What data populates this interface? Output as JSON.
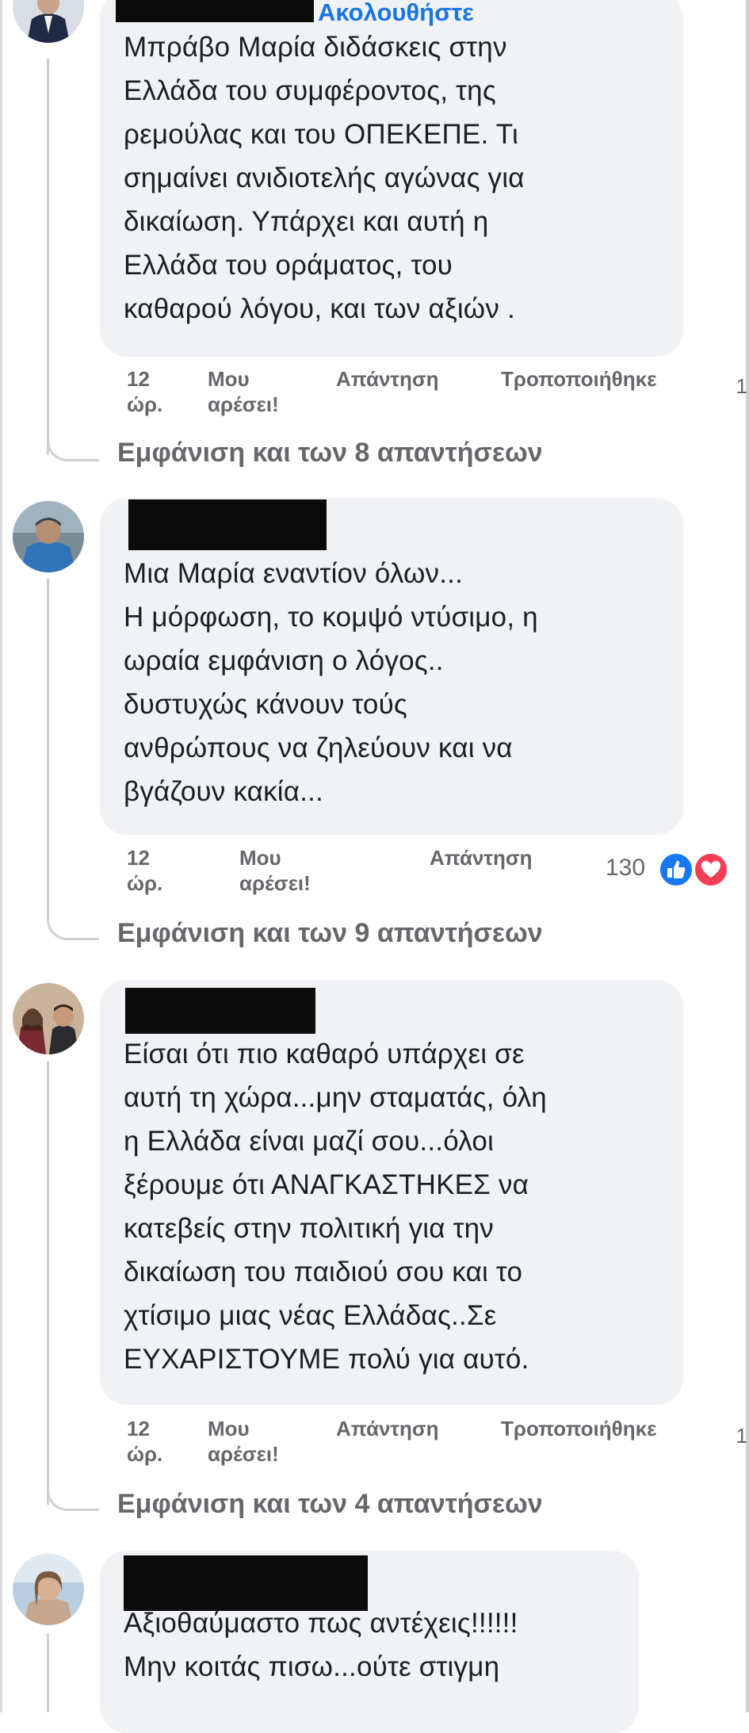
{
  "comments": [
    {
      "follow_label": "Ακολουθήστε",
      "text": "Μπράβο Μαρία διδάσκεις στην\nΕλλάδα του συμφέροντος, της\nρεμούλας και του ΟΠΕΚΕΠΕ. Τι\nσημαίνει ανιδιοτελής αγώνας για\nδικαίωση. Υπάρχει και αυτή η\nΕλλάδα του οράματος, του\nκαθαρού λόγου, και των αξιών .",
      "time": "12\nώρ.",
      "like": "Μου\nαρέσει!",
      "reply": "Απάντηση",
      "edited": "Τροποποιήθηκε",
      "edge_glyph": "1",
      "view_replies": "Εμφάνιση και των 8 απαντήσεων"
    },
    {
      "text": "Μια Μαρία εναντίον όλων...\nΗ μόρφωση, το κομψό ντύσιμο, η\nωραία εμφάνιση ο λόγος..\nδυστυχώς κάνουν τούς\nανθρώπους να ζηλεύουν και να\nβγάζουν κακία...",
      "time": "12\nώρ.",
      "like": "Μου\nαρέσει!",
      "reply": "Απάντηση",
      "reaction_count": "130",
      "view_replies": "Εμφάνιση και των 9 απαντήσεων"
    },
    {
      "text": "Είσαι ότι πιο καθαρό υπάρχει σε\nαυτή τη χώρα...μην σταματάς, όλη\nη Ελλάδα είναι μαζί σου...όλοι\nξέρουμε ότι ΑΝΑΓΚΑΣΤΗΚΕΣ να\nκατεβείς στην πολιτική για την\nδικαίωση του παιδιού σου και το\nχτίσιμο μιας νέας Ελλάδας..Σε\nΕΥΧΑΡΙΣΤΟΥΜΕ πολύ για αυτό.",
      "time": "12\nώρ.",
      "like": "Μου\nαρέσει!",
      "reply": "Απάντηση",
      "edited": "Τροποποιήθηκε",
      "edge_glyph": "1",
      "view_replies": "Εμφάνιση και των 4 απαντήσεων"
    },
    {
      "text": "Αξιοθαύμαστο πως αντέχεις!!!!!!\nΜην κοιτάς πισω...ούτε στιγμη"
    }
  ],
  "colors": {
    "bubble": "#f0f2f5",
    "meta_text": "#65676b",
    "follow_link": "#1b74e4",
    "like_reaction": "#1877f2",
    "love_reaction": "#f33e58"
  },
  "icons": [
    "like-reaction-icon",
    "love-reaction-icon"
  ]
}
